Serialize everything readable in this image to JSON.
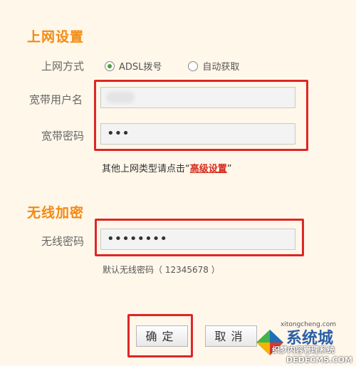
{
  "sections": {
    "internet_settings_title": "上网设置",
    "wireless_encryption_title": "无线加密"
  },
  "fields": {
    "internet_mode_label": "上网方式",
    "broadband_username_label": "宽带用户名",
    "broadband_password_label": "宽带密码",
    "wireless_password_label": "无线密码"
  },
  "radio": {
    "option_adsl": "ADSL拨号",
    "option_auto": "自动获取"
  },
  "values": {
    "broadband_password_masked": "•••",
    "wireless_password_masked": "••••••••"
  },
  "hints": {
    "other_types_prefix": "其他上网类型请点击“",
    "advanced_link": "高级设置",
    "other_types_suffix": "”",
    "default_wireless_password": "默认无线密码（ 12345678 ）"
  },
  "buttons": {
    "confirm": "确定",
    "cancel": "取消"
  },
  "watermark": {
    "brand_line1": "系统城",
    "brand_line2": "xitongcheng.com",
    "cms_line1": "织梦内容管理系统",
    "cms_line2": "DEDECMS.COM"
  },
  "colors": {
    "section_title": "#f28a12",
    "highlight_red": "#de2626",
    "link_red": "#d62b1b",
    "background": "#fff7ea"
  }
}
